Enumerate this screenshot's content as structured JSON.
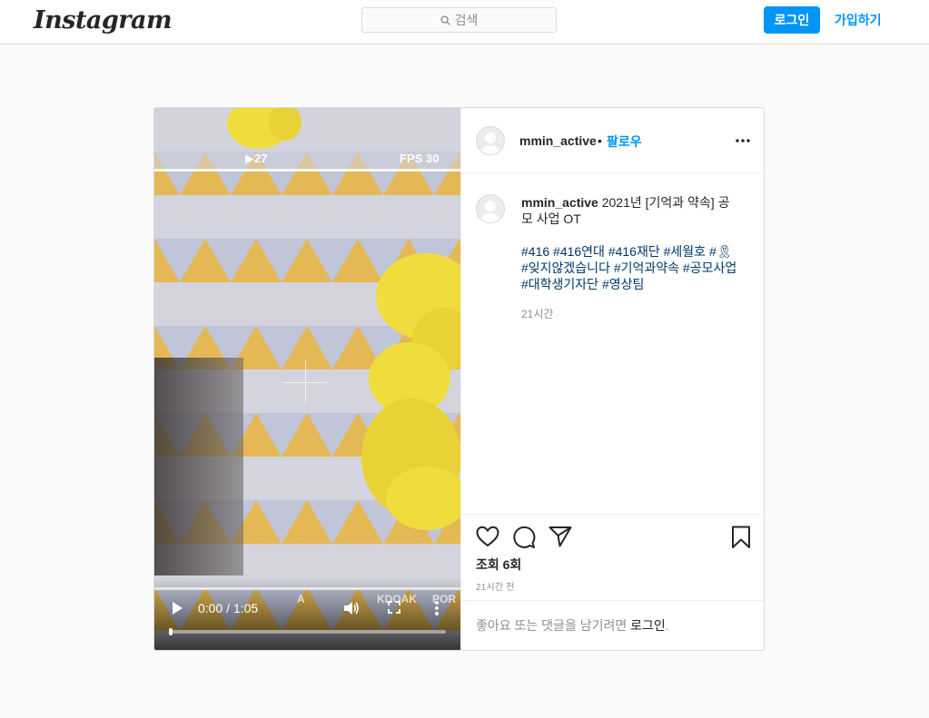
{
  "nav": {
    "logo": "Instagram",
    "search_placeholder": "검색",
    "login_label": "로그인",
    "signup_label": "가입하기"
  },
  "video": {
    "overlay_top_left": "▶27",
    "overlay_top_right": "FPS 30",
    "overlay_bottom_a": "A",
    "overlay_bottom_b": "KDOAK",
    "overlay_bottom_c": "POR",
    "time": "0:00 / 1:05",
    "progress_fraction": 0
  },
  "post": {
    "username": "mmin_active",
    "follow_dot": "•",
    "follow_label": "팔로우",
    "caption_text": "2021년 [기억과 약속] 공모 사업 OT",
    "caption_tags": "#416 #416연대 #416재단 #세월호 #🎗 #잊지않겠습니다 #기억과약속 #공모사업 #대학생기자단 #영상팀",
    "caption_time": "21시간",
    "views": "조회 6회",
    "ago": "21시간 전",
    "comment_prompt": "좋아요 또는 댓글을 남기려면",
    "comment_login": "로그인",
    "comment_suffix": "."
  },
  "icons": {
    "search": "search-icon",
    "like": "heart-icon",
    "comment": "comment-icon",
    "share": "paper-plane-icon",
    "save": "bookmark-icon",
    "more": "more-horizontal-icon"
  },
  "colors": {
    "accent": "#0095f6",
    "hashtag": "#00376b",
    "muted": "#8e8e8e"
  }
}
